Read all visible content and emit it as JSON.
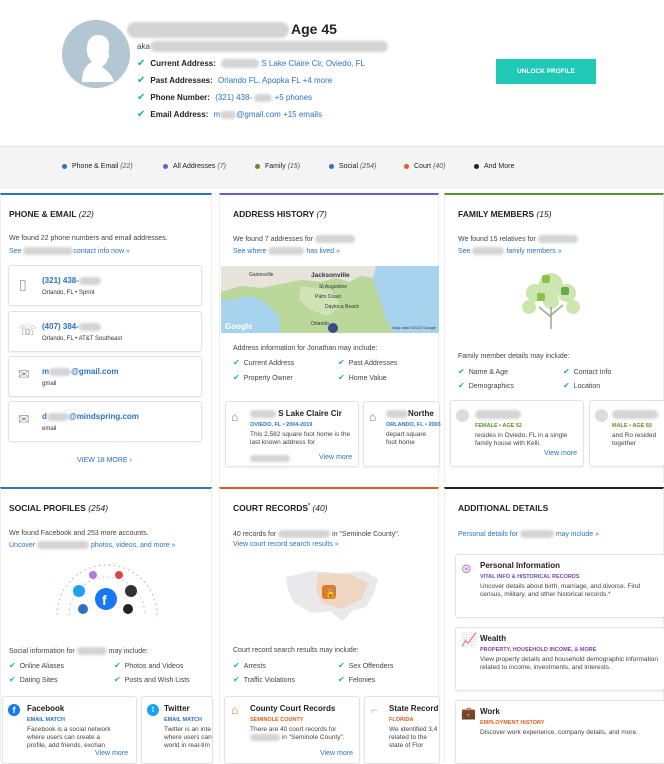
{
  "profile": {
    "age": "Age 45",
    "aka": "aka",
    "rows": [
      {
        "label": "Current Address:",
        "value": "S Lake Claire Cir, Oviedo, FL"
      },
      {
        "label": "Past Addresses:",
        "value": "Orlando FL, Apopka FL +4 more"
      },
      {
        "label": "Phone Number:",
        "value": "(321) 438-",
        "extra": "+5 phones"
      },
      {
        "label": "Email Address:",
        "value": "m",
        "extra": "@gmail.com +15 emails"
      }
    ],
    "unlock": "UNLOCK PROFILE"
  },
  "tabs": [
    {
      "label": "Phone & Email",
      "count": "(22)",
      "color": "#2b72c2"
    },
    {
      "label": "All Addresses",
      "count": "(7)",
      "color": "#6a5bd0"
    },
    {
      "label": "Family",
      "count": "(15)",
      "color": "#5d8f2a"
    },
    {
      "label": "Social",
      "count": "(254)",
      "color": "#3a6fb3"
    },
    {
      "label": "Court",
      "count": "(40)",
      "color": "#e0601a"
    },
    {
      "label": "And More",
      "count": "",
      "color": "#222"
    }
  ],
  "phone": {
    "title": "PHONE & EMAIL",
    "count": "(22)",
    "found": "We found 22 phone numbers and email addresses.",
    "see": "See",
    "see2": "contact info now »",
    "items": [
      {
        "main": "(321) 438-",
        "sub": "Orlando, FL • Sprint",
        "icon": "mobile-phone-icon"
      },
      {
        "main": "(407) 384-",
        "sub": "Orlando, FL • AT&T Southeast",
        "icon": "landline-phone-icon"
      },
      {
        "main": "m",
        "main2": "@gmail.com",
        "sub": "gmail",
        "icon": "email-icon"
      },
      {
        "main": "d",
        "main2": "@mindspring.com",
        "sub": "email",
        "icon": "email-icon"
      }
    ],
    "viewmore": "VIEW 18 MORE ›"
  },
  "address": {
    "title": "ADDRESS HISTORY",
    "count": "(7)",
    "found": "We found 7 addresses for",
    "see": "See where",
    "see2": "has lived »",
    "map": {
      "cities": [
        "Jacksonville",
        "Gainesville",
        "St Augustine",
        "Palm Coast",
        "Daytona Beach",
        "Orlando"
      ],
      "google": "Google",
      "credit": "Map data ©2023 Google"
    },
    "info": "Address information for Jonathan may include:",
    "items": [
      "Current Address",
      "Past Addresses",
      "Property Owner",
      "Home Value"
    ],
    "cards": [
      {
        "title": "S Lake Claire Cir",
        "city": "OVIEDO, FL • 2004-2019",
        "desc": "This 2,582 square foot home is the last known address for",
        "more": "View more"
      },
      {
        "title": "Northe",
        "city": "ORLANDO, FL • 2003",
        "desc": "depart square foot home",
        "more": ""
      }
    ]
  },
  "family": {
    "title": "FAMILY MEMBERS",
    "count": "(15)",
    "found": "We found 15 relatives for",
    "see": "See",
    "see2": "family members »",
    "info": "Family member details may include:",
    "items": [
      "Name & Age",
      "Contact Info",
      "Demographics",
      "Location"
    ],
    "cards": [
      {
        "badge": "FEMALE • AGE 52",
        "desc": "resides in Oviedo, FL in a single family house with Kelli.",
        "more": "View more"
      },
      {
        "badge": "MALE • AGE 55",
        "desc": "and Ro resided together",
        "more": ""
      }
    ]
  },
  "social": {
    "title": "SOCIAL PROFILES",
    "count": "(254)",
    "found": "We found Facebook and 253 more accounts.",
    "see": "Uncover",
    "see2": "photos, videos, and more »",
    "info": "Social information for",
    "info2": "may include:",
    "items": [
      "Online Aliases",
      "Photos and Videos",
      "Dating Sites",
      "Posts and Wish Lists"
    ],
    "cards": [
      {
        "title": "Facebook",
        "badge": "EMAIL MATCH",
        "desc": "Facebook is a social network where users can create a profile, add friends, exchan",
        "more": "View more"
      },
      {
        "title": "Twitter",
        "badge": "EMAIL MATCH",
        "desc": "Twitter is an inte where users can world in real-tim",
        "more": "View more"
      }
    ]
  },
  "court": {
    "title": "COURT RECORDS",
    "count": "(40)",
    "found": "40 records for",
    "found2": "in \"Seminole County\".",
    "see": "View court record search results »",
    "info": "Court record search results may include:",
    "items": [
      "Arrests",
      "Sex Offenders",
      "Traffic Violations",
      "Felonies"
    ],
    "cards": [
      {
        "title": "County Court Records",
        "badge": "SEMINOLE COUNTY",
        "desc": "There are 40 court records for",
        "desc2": "in \"Seminole County\".",
        "more": "View more"
      },
      {
        "title": "State Record",
        "badge": "FLORIDA",
        "desc": "We identified 3,4 related to the state of Flor",
        "more": ""
      }
    ]
  },
  "additional": {
    "title": "ADDITIONAL DETAILS",
    "see": "Personal details for",
    "see2": "may include »",
    "cards": [
      {
        "title": "Personal Information",
        "badge": "VITAL INFO & HISTORICAL RECORDS",
        "desc": "Uncover details about birth, marriage, and divorce. Find census, military, and other historical records.*",
        "color": "#7a3fb8"
      },
      {
        "title": "Wealth",
        "badge": "PROPERTY, HOUSEHOLD INCOME, & MORE",
        "desc": "View property details and household demographic information related to income, investments, and interests.",
        "color": "#7a3fb8"
      },
      {
        "title": "Work",
        "badge": "EMPLOYMENT HISTORY",
        "desc": "Discover work experience, company details, and more.",
        "color": "#e0601a"
      }
    ]
  }
}
